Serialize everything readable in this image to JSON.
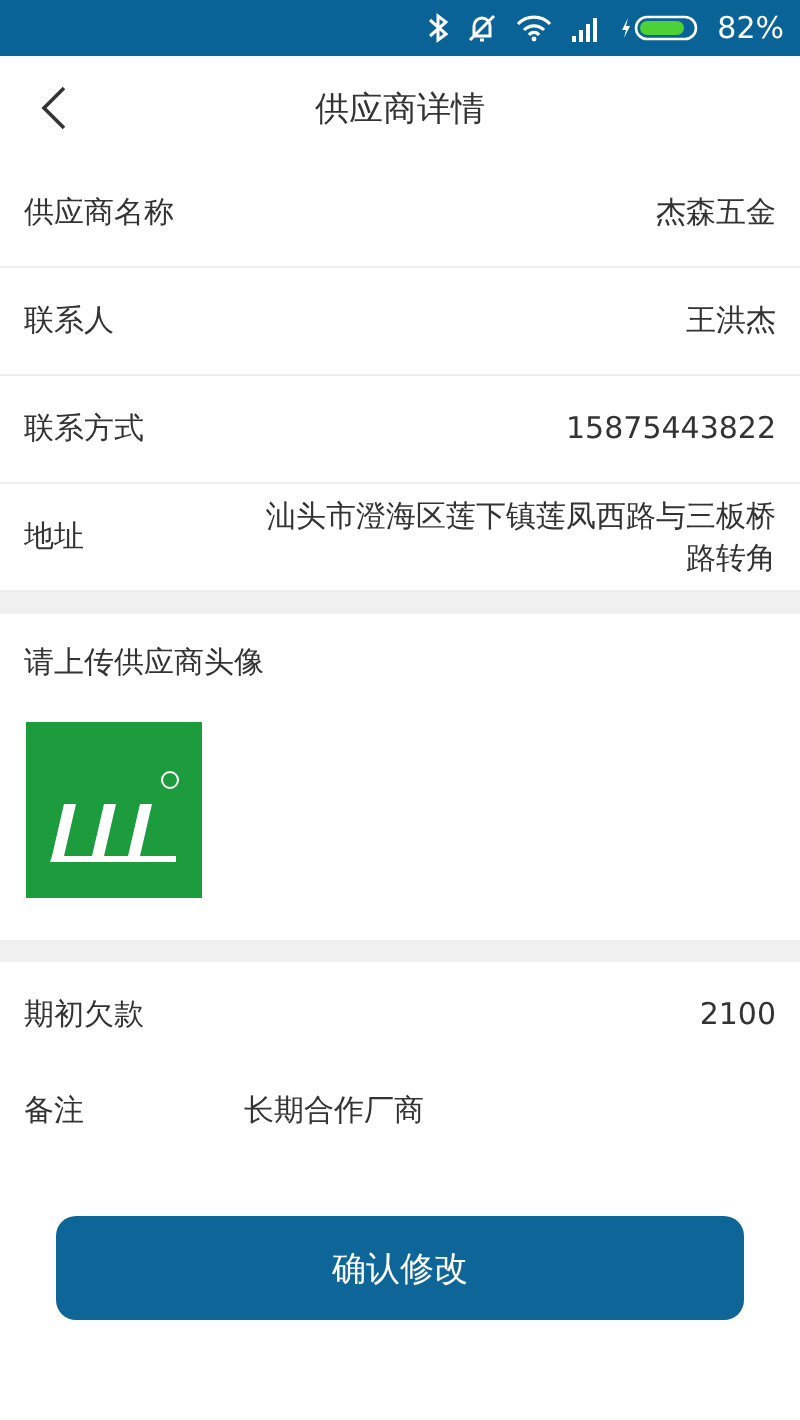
{
  "status_bar": {
    "battery_text": "82%"
  },
  "header": {
    "title": "供应商详情"
  },
  "info_rows": [
    {
      "label": "供应商名称",
      "value": "杰森五金"
    },
    {
      "label": "联系人",
      "value": "王洪杰"
    },
    {
      "label": "联系方式",
      "value": "15875443822"
    },
    {
      "label": "地址",
      "value": "汕头市澄海区莲下镇莲凤西路与三板桥路转角"
    }
  ],
  "avatar_section": {
    "label": "请上传供应商头像"
  },
  "extra_rows": [
    {
      "kind": "right",
      "label": "期初欠款",
      "value": "2100"
    },
    {
      "kind": "left",
      "label": "备注",
      "value": "长期合作厂商"
    }
  ],
  "confirm_button": {
    "label": "确认修改"
  }
}
